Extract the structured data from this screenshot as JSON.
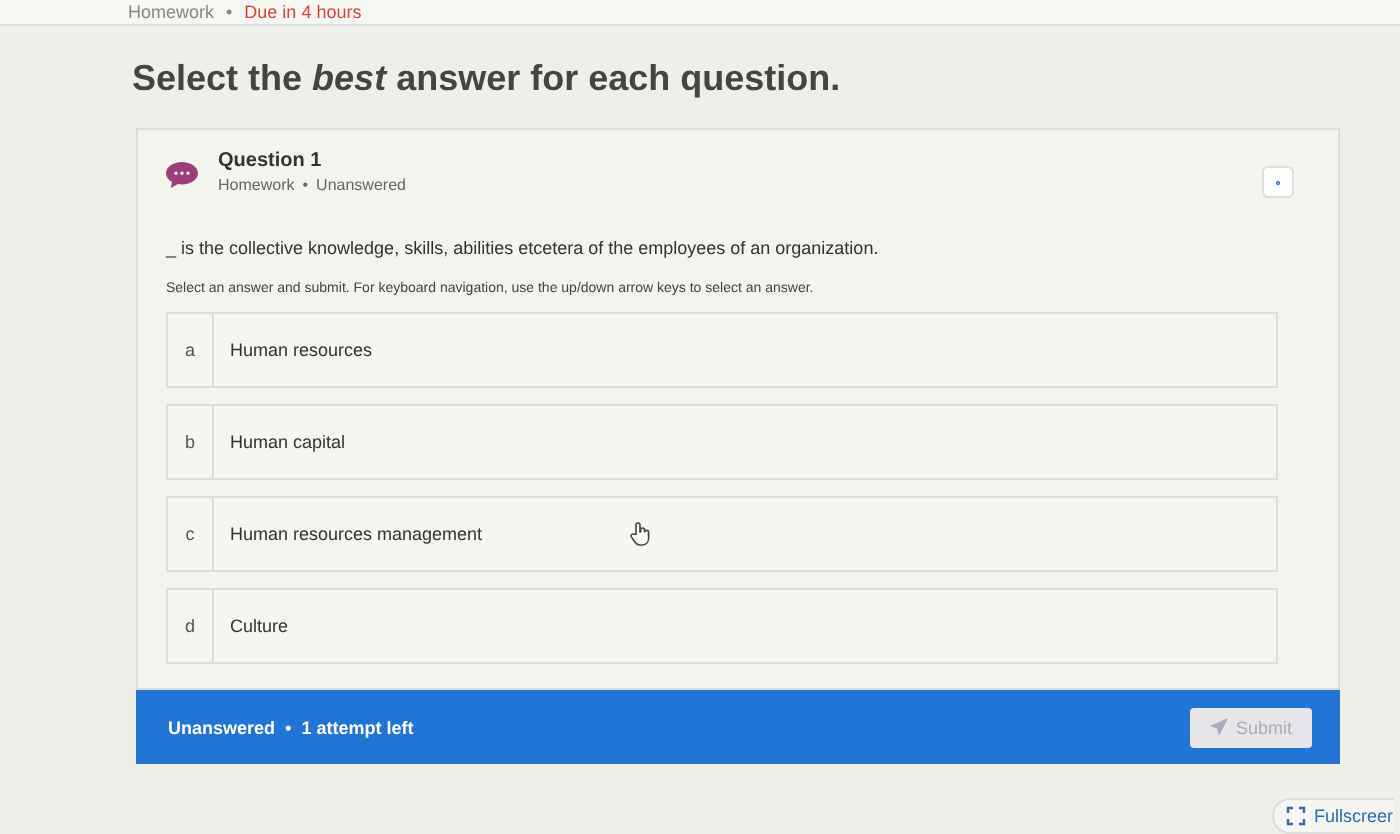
{
  "top_bar": {
    "label": "Homework",
    "separator": "•",
    "due": "Due in 4 hours"
  },
  "heading": "Select the *best* answer for each question.",
  "question": {
    "title": "Question 1",
    "type": "Homework",
    "separator": "•",
    "status": "Unanswered",
    "prompt": "_ is the collective knowledge, skills, abilities etcetera of the employees of an organization.",
    "instructions": "Select an answer and submit. For keyboard navigation, use the up/down arrow keys to select an answer.",
    "options": [
      {
        "letter": "a",
        "text": "Human resources",
        "selected": false
      },
      {
        "letter": "b",
        "text": "Human capital",
        "selected": false
      },
      {
        "letter": "c",
        "text": "Human resources management",
        "selected": false
      },
      {
        "letter": "d",
        "text": "Culture",
        "selected": false
      }
    ]
  },
  "footer": {
    "status": "Unanswered",
    "separator": "•",
    "attempts": "1 attempt left",
    "submit": {
      "label": "Submit",
      "disabled": true
    }
  },
  "fullscreen": "Fullscreer"
}
